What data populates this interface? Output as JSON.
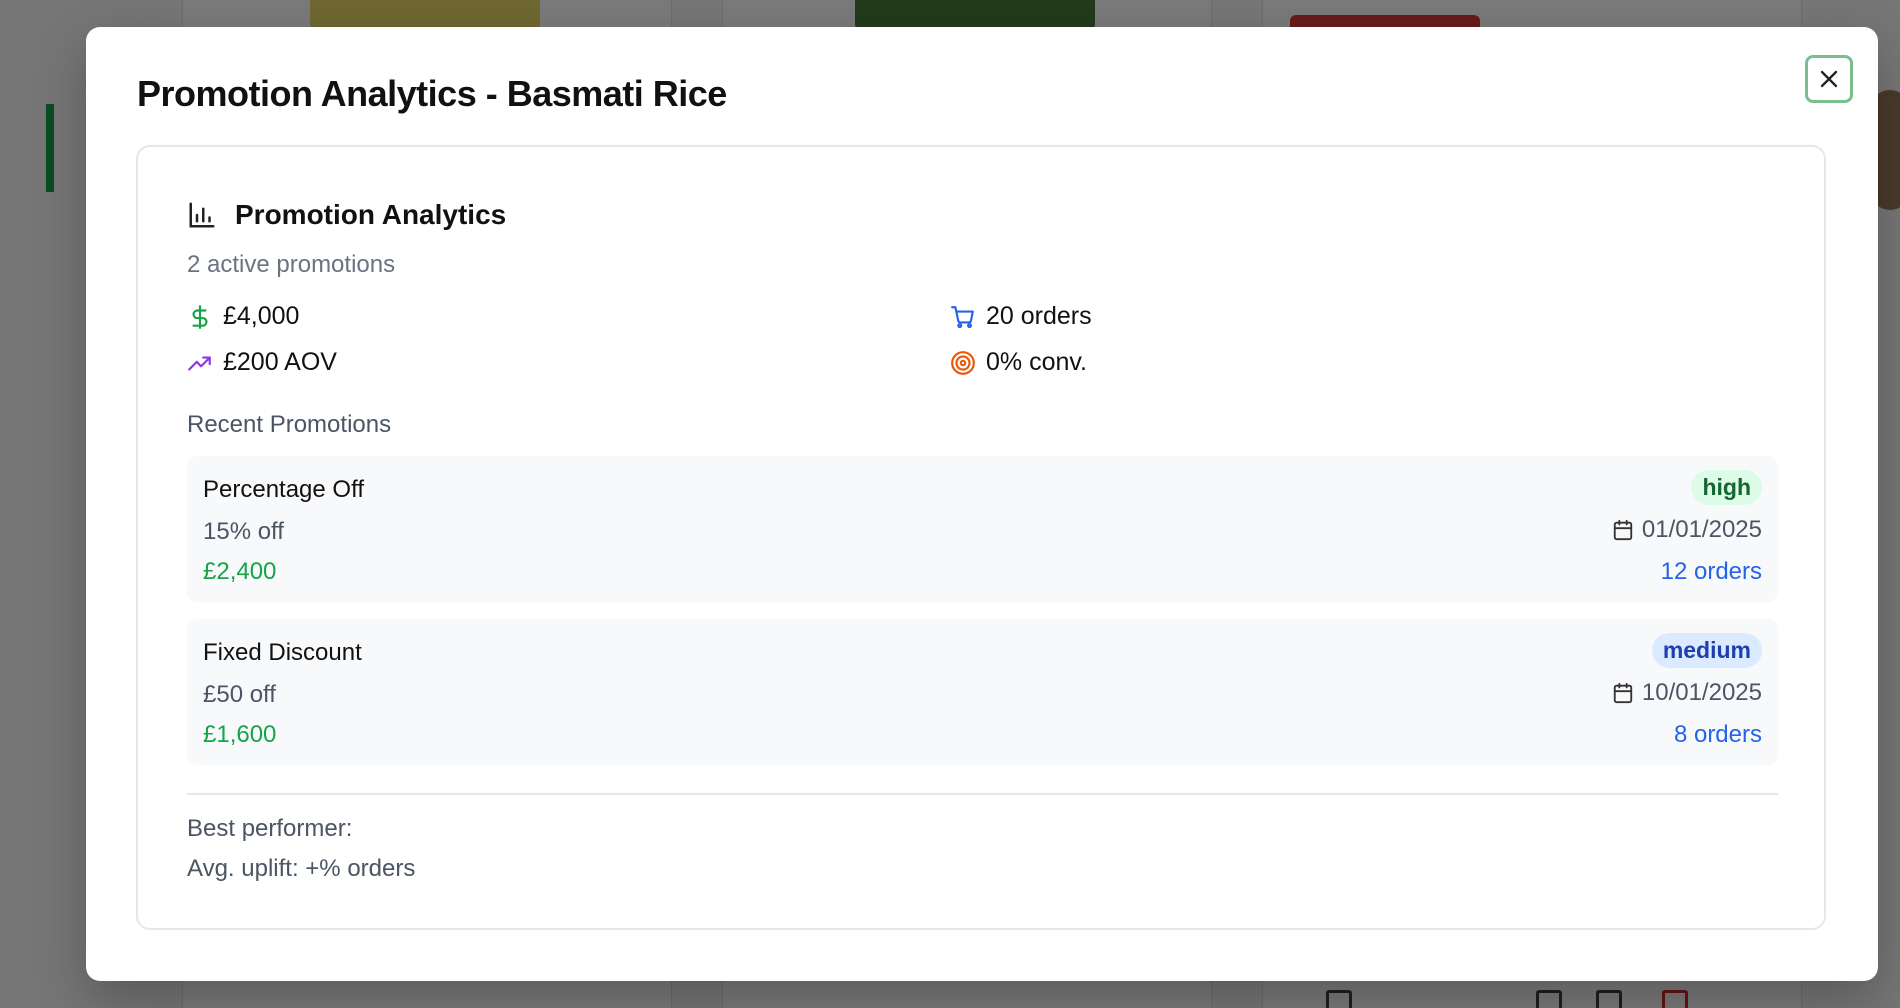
{
  "modal": {
    "title": "Promotion Analytics - Basmati Rice",
    "close_label": "Close"
  },
  "card": {
    "title": "Promotion Analytics",
    "subtitle": "2 active promotions",
    "stats": {
      "revenue": "£4,000",
      "orders": "20 orders",
      "aov": "£200 AOV",
      "conversion": "0% conv."
    },
    "section_label": "Recent Promotions",
    "promotions": [
      {
        "name": "Percentage Off",
        "discount": "15% off",
        "revenue": "£2,400",
        "priority": "high",
        "date": "01/01/2025",
        "orders": "12 orders"
      },
      {
        "name": "Fixed Discount",
        "discount": "£50 off",
        "revenue": "£1,600",
        "priority": "medium",
        "date": "10/01/2025",
        "orders": "8 orders"
      }
    ],
    "best_performer": "Best performer:",
    "avg_uplift": "Avg. uplift: +% orders"
  },
  "icons": {
    "header": "bar-chart-icon",
    "revenue": "dollar-icon",
    "orders": "cart-icon",
    "aov": "trending-up-icon",
    "conversion": "target-icon",
    "date": "calendar-icon"
  },
  "colors": {
    "revenue_green": "#16a34a",
    "orders_blue": "#2563eb",
    "aov_purple": "#9333ea",
    "conversion_orange": "#ea580c",
    "close_border": "#7bbf8e"
  }
}
